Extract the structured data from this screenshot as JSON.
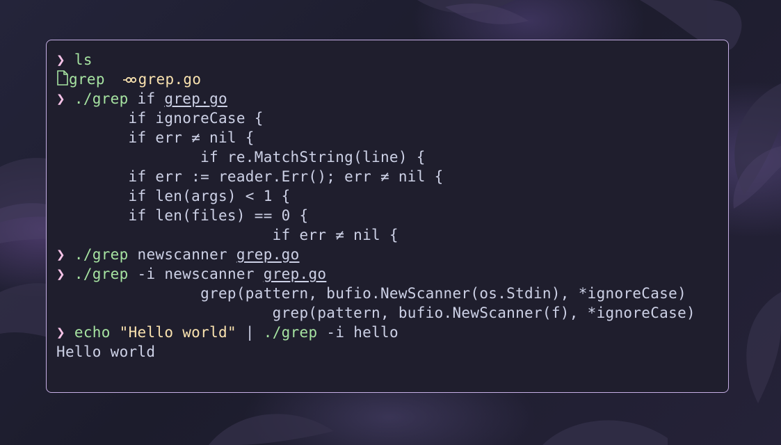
{
  "terminal": {
    "prompt_symbol": "❯",
    "lines": [
      {
        "type": "cmd",
        "cmd": "ls"
      },
      {
        "type": "ls",
        "exec_name": "grep",
        "link_name": "grep.go"
      },
      {
        "type": "cmd",
        "cmd": "./grep",
        "args": "if",
        "file": "grep.go"
      },
      {
        "type": "out",
        "text": "        if ignoreCase {"
      },
      {
        "type": "out",
        "text": "        if err ≠ nil {"
      },
      {
        "type": "out",
        "text": "                if re.MatchString(line) {"
      },
      {
        "type": "out",
        "text": "        if err := reader.Err(); err ≠ nil {"
      },
      {
        "type": "out",
        "text": "        if len(args) < 1 {"
      },
      {
        "type": "out",
        "text": "        if len(files) == 0 {"
      },
      {
        "type": "out",
        "text": "                        if err ≠ nil {"
      },
      {
        "type": "cmd",
        "cmd": "./grep",
        "args": "newscanner",
        "file": "grep.go"
      },
      {
        "type": "cmd",
        "cmd": "./grep",
        "args": "-i newscanner",
        "file": "grep.go"
      },
      {
        "type": "out",
        "text": "                grep(pattern, bufio.NewScanner(os.Stdin), *ignoreCase)"
      },
      {
        "type": "out",
        "text": "                        grep(pattern, bufio.NewScanner(f), *ignoreCase)"
      },
      {
        "type": "pipe",
        "cmd": "echo",
        "str": "\"Hello world\"",
        "pipe": "|",
        "cmd2": "./grep",
        "args": "-i hello"
      },
      {
        "type": "out",
        "text": "Hello world"
      }
    ]
  },
  "icons": {
    "file_icon": "file-icon",
    "link_icon": "chain-link-icon"
  },
  "colors": {
    "prompt": "#f5c2e7",
    "command": "#a6e3a1",
    "string": "#f9e2af",
    "text": "#cdd1e6",
    "border": "#c7b0e6",
    "background": "#1f1e2d"
  }
}
